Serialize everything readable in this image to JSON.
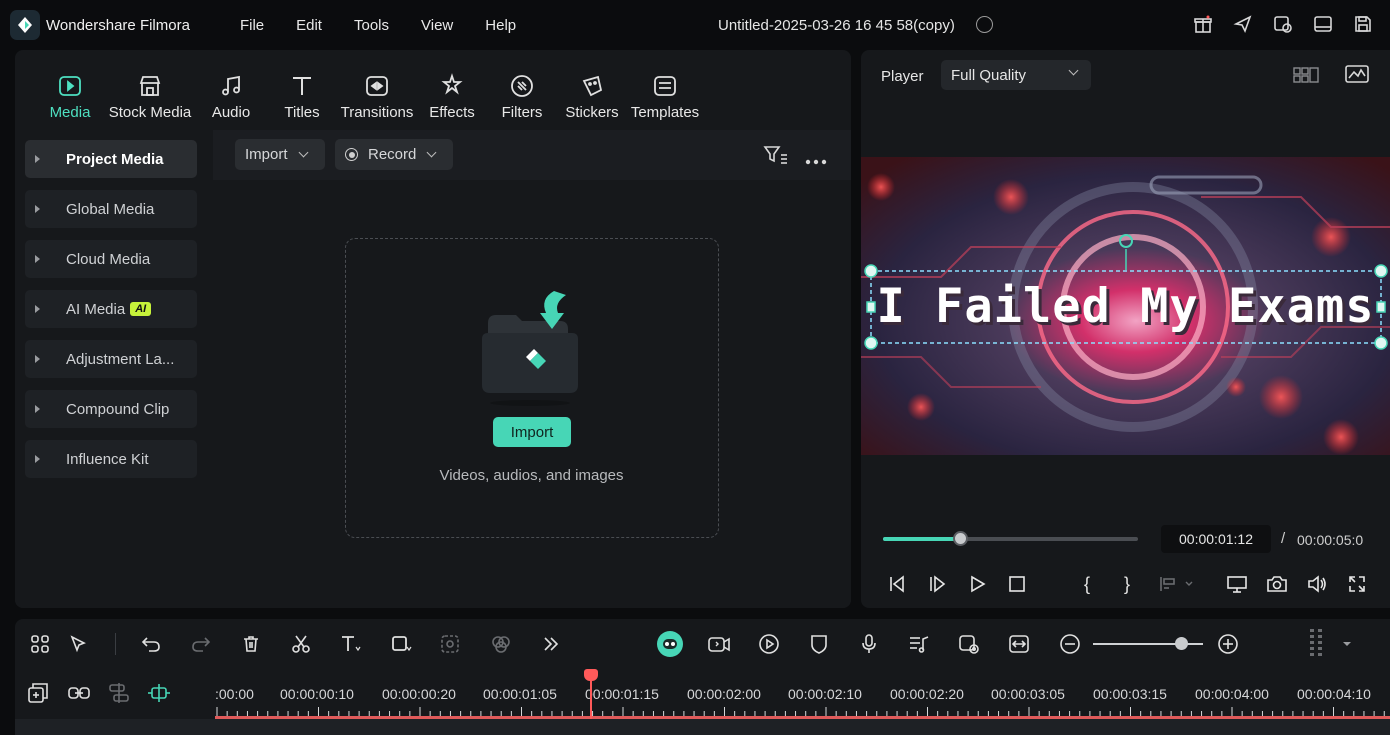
{
  "app": {
    "name": "Wondershare Filmora",
    "project_title": "Untitled-2025-03-26 16 45 58(copy)",
    "menu": [
      "File",
      "Edit",
      "Tools",
      "View",
      "Help"
    ]
  },
  "top_icons": [
    "gift-icon",
    "send-icon",
    "project-clock-icon",
    "window-icon",
    "save-icon"
  ],
  "tools": [
    {
      "label": "Media",
      "icon": "media-icon",
      "active": true
    },
    {
      "label": "Stock Media",
      "icon": "stock-media-icon"
    },
    {
      "label": "Audio",
      "icon": "music-note-icon"
    },
    {
      "label": "Titles",
      "icon": "titles-icon"
    },
    {
      "label": "Transitions",
      "icon": "transitions-icon"
    },
    {
      "label": "Effects",
      "icon": "effects-icon"
    },
    {
      "label": "Filters",
      "icon": "filters-icon"
    },
    {
      "label": "Stickers",
      "icon": "stickers-icon"
    },
    {
      "label": "Templates",
      "icon": "templates-icon"
    }
  ],
  "sidebar": {
    "items": [
      {
        "label": "Project Media",
        "active": true
      },
      {
        "label": "Global Media"
      },
      {
        "label": "Cloud Media"
      },
      {
        "label": "AI Media",
        "badge": "AI"
      },
      {
        "label": "Adjustment La..."
      },
      {
        "label": "Compound Clip"
      },
      {
        "label": "Influence Kit"
      }
    ]
  },
  "content": {
    "import_dropdown": "Import",
    "record_dropdown": "Record",
    "import_button": "Import",
    "drop_hint": "Videos, audios, and images"
  },
  "player": {
    "label": "Player",
    "quality": "Full Quality",
    "overlay_title": "I Failed My Exams",
    "current_time": "00:00:01:12",
    "separator": "/",
    "total_time": "00:00:05:0",
    "progress_fraction": 0.3
  },
  "timeline": {
    "ticks": [
      ":00:00",
      "00:00:00:10",
      "00:00:00:20",
      "00:00:01:05",
      "00:00:01:15",
      "00:00:02:00",
      "00:00:02:10",
      "00:00:02:20",
      "00:00:03:05",
      "00:00:03:15",
      "00:00:04:00",
      "00:00:04:10"
    ],
    "zoom_fraction": 0.8
  },
  "colors": {
    "accent": "#47d6b6",
    "playhead": "#ff5a5a",
    "panel": "#16181b",
    "background": "#0b0c0e"
  }
}
